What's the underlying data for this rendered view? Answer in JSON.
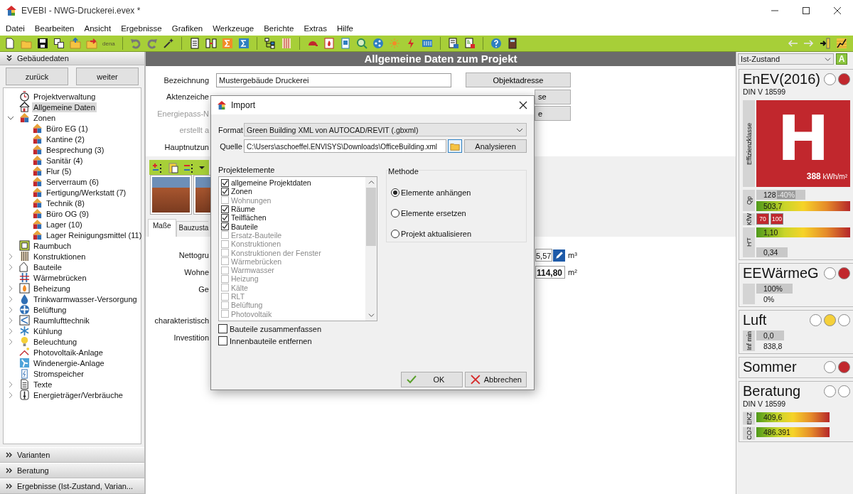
{
  "window": {
    "title": "EVEBI - NWG-Druckerei.evex *"
  },
  "menu": [
    "Datei",
    "Bearbeiten",
    "Ansicht",
    "Ergebnisse",
    "Grafiken",
    "Werkzeuge",
    "Berichte",
    "Extras",
    "Hilfe"
  ],
  "toolbar": {
    "dena_label": "dena"
  },
  "sidebar": {
    "header": "Gebäudedaten",
    "back": "zurück",
    "next": "weiter",
    "tree": [
      {
        "label": "Projektverwaltung",
        "selected": false
      },
      {
        "label": "Allgemeine Daten",
        "selected": true
      },
      {
        "label": "Zonen",
        "selected": false,
        "expanded": true,
        "children": [
          {
            "label": "Büro EG (1)",
            "selected": false
          },
          {
            "label": "Kantine (2)",
            "selected": false
          },
          {
            "label": "Besprechung (3)",
            "selected": false
          },
          {
            "label": "Sanitär (4)",
            "selected": false
          },
          {
            "label": "Flur (5)",
            "selected": false
          },
          {
            "label": "Serverraum (6)",
            "selected": false
          },
          {
            "label": "Fertigung/Werkstatt (7)",
            "selected": false
          },
          {
            "label": "Technik (8)",
            "selected": false
          },
          {
            "label": "Büro OG (9)",
            "selected": false
          },
          {
            "label": "Lager (10)",
            "selected": false
          },
          {
            "label": "Lager Reinigungsmittel (11)",
            "selected": false
          }
        ]
      },
      {
        "label": "Raumbuch",
        "selected": false
      },
      {
        "label": "Konstruktionen",
        "selected": false,
        "expanded": false
      },
      {
        "label": "Bauteile",
        "selected": false,
        "expanded": false
      },
      {
        "label": "Wärmebrücken",
        "selected": false
      },
      {
        "label": "Beheizung",
        "selected": false,
        "expanded": false
      },
      {
        "label": "Trinkwarmwasser-Versorgung",
        "selected": false,
        "expanded": false
      },
      {
        "label": "Belüftung",
        "selected": false,
        "expanded": false
      },
      {
        "label": "Raumlufttechnik",
        "selected": false,
        "expanded": false
      },
      {
        "label": "Kühlung",
        "selected": false,
        "expanded": false
      },
      {
        "label": "Beleuchtung",
        "selected": false,
        "expanded": false
      },
      {
        "label": "Photovoltaik-Anlage",
        "selected": false
      },
      {
        "label": "Windenergie-Anlage",
        "selected": false
      },
      {
        "label": "Stromspeicher",
        "selected": false
      },
      {
        "label": "Texte",
        "selected": false,
        "expanded": false
      },
      {
        "label": "Energieträger/Verbräuche",
        "selected": false,
        "expanded": false
      }
    ],
    "sections": [
      "Varianten",
      "Beratung",
      "Ergebnisse (Ist-Zustand, Varian..."
    ]
  },
  "main": {
    "title": "Allgemeine Daten zum Projekt",
    "fields": [
      {
        "label": "Bezeichnung",
        "value": "Mustergebäude Druckerei",
        "disabled": false
      },
      {
        "label": "Aktenzeiche",
        "disabled": false
      },
      {
        "label": "Energiepass-N",
        "disabled": true
      },
      {
        "label": "erstellt a",
        "disabled": true
      },
      {
        "label": "Hauptnutzun",
        "disabled": false
      }
    ],
    "buttons": [
      "Objektadresse",
      "se",
      "e"
    ],
    "tabs": [
      {
        "label": "Maße",
        "selected": true
      },
      {
        "label": "Bauzusta",
        "selected": false
      }
    ],
    "measures": [
      {
        "label": "Nettogru",
        "value": "5,57",
        "unit": "m³",
        "kind": "editable"
      },
      {
        "label": "Wohne",
        "value": "114,80",
        "unit": "m²",
        "kind": "computed"
      },
      {
        "label": "Ge"
      },
      {
        "label": "charakteristisch"
      },
      {
        "label": "Investition"
      }
    ]
  },
  "dialog": {
    "title": "Import",
    "format_label": "Format",
    "format_value": "Green Building XML von AUTOCAD/REVIT (.gbxml)",
    "source_label": "Quelle",
    "source_value": "C:\\Users\\aschoeffel.ENVISYS\\Downloads\\OfficeBuilding.xml",
    "analyze": "Analysieren",
    "elements_label": "Projektelemente",
    "elements": [
      {
        "label": "allgemeine Projektdaten",
        "checked": true,
        "disabled": false
      },
      {
        "label": "Zonen",
        "checked": true,
        "disabled": false
      },
      {
        "label": "Wohnungen",
        "checked": false,
        "disabled": true
      },
      {
        "label": "Räume",
        "checked": true,
        "disabled": false
      },
      {
        "label": "Teilflächen",
        "checked": true,
        "disabled": false
      },
      {
        "label": "Bauteile",
        "checked": true,
        "disabled": false
      },
      {
        "label": "Ersatz-Bauteile",
        "checked": false,
        "disabled": true
      },
      {
        "label": "Konstruktionen",
        "checked": false,
        "disabled": true
      },
      {
        "label": "Konstruktionen der Fenster",
        "checked": false,
        "disabled": true
      },
      {
        "label": "Wärmebrücken",
        "checked": false,
        "disabled": true
      },
      {
        "label": "Warmwasser",
        "checked": false,
        "disabled": true
      },
      {
        "label": "Heizung",
        "checked": false,
        "disabled": true
      },
      {
        "label": "Kälte",
        "checked": false,
        "disabled": true
      },
      {
        "label": "RLT",
        "checked": false,
        "disabled": true
      },
      {
        "label": "Belüftung",
        "checked": false,
        "disabled": true
      },
      {
        "label": "Photovoltaik",
        "checked": false,
        "disabled": true
      }
    ],
    "method_label": "Methode",
    "methods": [
      {
        "label": "Elemente anhängen",
        "selected": true
      },
      {
        "label": "Elemente ersetzen",
        "selected": false
      },
      {
        "label": "Projekt aktualisieren",
        "selected": false
      }
    ],
    "options": [
      {
        "label": "Bauteile zusammenfassen",
        "checked": false
      },
      {
        "label": "Innenbauteile entfernen",
        "checked": false
      }
    ],
    "ok": "OK",
    "cancel": "Abbrechen"
  },
  "assessment": {
    "state": "Ist-Zustand",
    "badge": "A",
    "sections": [
      {
        "title": "EnEV(2016)",
        "lights": [
          {
            "lit": false
          },
          {
            "lit": true,
            "color": "#c1272d"
          }
        ],
        "norm": "DIN V 18599",
        "class_label": "Effizienzklasse",
        "class": "H",
        "energy": "388",
        "energy_unit": "kWh/m²",
        "rows": [
          {
            "label": "Qp",
            "items": [
              {
                "kind": "grey",
                "text": "128",
                "tag": "-40%"
              },
              {
                "kind": "gradient",
                "text": "503,7"
              }
            ]
          },
          {
            "label": "KfW",
            "items": [
              {
                "kind": "chip",
                "text": "70"
              },
              {
                "kind": "chip",
                "text": "100"
              }
            ]
          },
          {
            "label": "H'$_{T}$",
            "items": [
              {
                "kind": "gradient",
                "text": "1,10"
              },
              {
                "kind": "gap"
              },
              {
                "kind": "grey",
                "text": "0,34"
              }
            ]
          }
        ]
      },
      {
        "title": "EEWärmeG",
        "lights": [
          {
            "lit": false
          },
          {
            "lit": true,
            "color": "#c1272d"
          }
        ],
        "rows": [
          {
            "items": [
              {
                "kind": "grey",
                "text": "100%"
              },
              {
                "kind": "plain",
                "text": "0%"
              }
            ]
          }
        ]
      },
      {
        "title": "Luft",
        "lights": [
          {
            "lit": false
          },
          {
            "lit": true,
            "color": "#f5d03a"
          },
          {
            "lit": false
          }
        ],
        "rows": [
          {
            "label": "Inf min",
            "items": [
              {
                "kind": "grey",
                "text": "0,0"
              },
              {
                "kind": "plain",
                "text": "838,8"
              }
            ]
          }
        ]
      },
      {
        "title": "Sommer",
        "lights": [
          {
            "lit": false
          },
          {
            "lit": true,
            "color": "#c1272d"
          }
        ]
      },
      {
        "title": "Beratung",
        "lights": [
          {
            "lit": false
          },
          {
            "lit": false
          }
        ],
        "norm": "DIN V 18599",
        "rows": [
          {
            "label": "EKZ",
            "items": [
              {
                "kind": "gradient",
                "text": "409,6"
              }
            ]
          },
          {
            "label": "CO$_{2}$",
            "items": [
              {
                "kind": "gradient",
                "text": "486.391"
              }
            ]
          }
        ]
      }
    ]
  }
}
